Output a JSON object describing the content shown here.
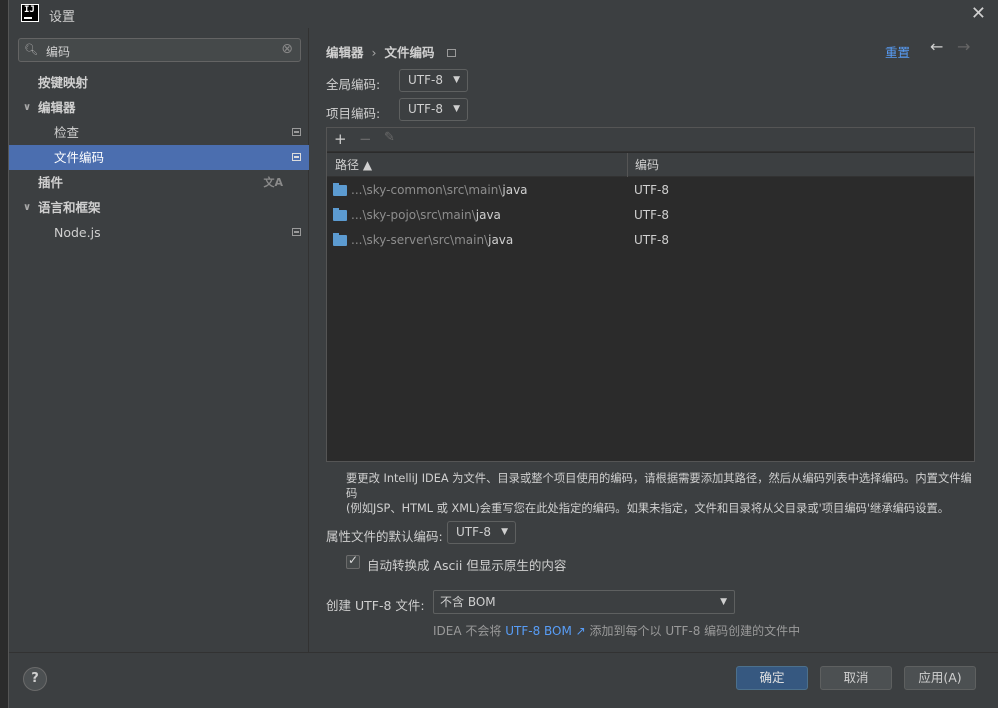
{
  "window": {
    "title": "设置"
  },
  "sidebar": {
    "search": {
      "value": "编码"
    },
    "items": [
      {
        "label": "按键映射"
      },
      {
        "label": "编辑器"
      },
      {
        "label": "检查"
      },
      {
        "label": "文件编码"
      },
      {
        "label": "插件"
      },
      {
        "label": "语言和框架"
      },
      {
        "label": "Node.js"
      }
    ]
  },
  "main": {
    "breadcrumb": {
      "parent": "编辑器",
      "separator": "›",
      "current": "文件编码"
    },
    "reset": "重置",
    "global_encoding": {
      "label": "全局编码:",
      "value": "UTF-8"
    },
    "project_encoding": {
      "label": "项目编码:",
      "value": "UTF-8"
    },
    "table": {
      "columns": [
        "路径 ▲",
        "编码"
      ],
      "rows": [
        {
          "path_prefix": "...\\sky-common\\src\\main\\",
          "path_leaf": "java",
          "encoding": "UTF-8"
        },
        {
          "path_prefix": "...\\sky-pojo\\src\\main\\",
          "path_leaf": "java",
          "encoding": "UTF-8"
        },
        {
          "path_prefix": "...\\sky-server\\src\\main\\",
          "path_leaf": "java",
          "encoding": "UTF-8"
        }
      ]
    },
    "description_line1": "要更改 IntelliJ IDEA 为文件、目录或整个项目使用的编码，请根据需要添加其路径，然后从编码列表中选择编码。内置文件编码",
    "description_line2": "(例如JSP、HTML 或 XML)会重写您在此处指定的编码。如果未指定，文件和目录将从父目录或'项目编码'继承编码设置。",
    "properties_encoding": {
      "label": "属性文件的默认编码:",
      "value": "UTF-8"
    },
    "native_to_ascii": {
      "label": "自动转换成 Ascii 但显示原生的内容",
      "checked": true
    },
    "bom": {
      "label": "创建 UTF-8 文件:",
      "value": "不含 BOM"
    },
    "hint": {
      "prefix": "IDEA 不会将",
      "link": "UTF-8 BOM ↗",
      "suffix": "添加到每个以 UTF-8 编码创建的文件中"
    }
  },
  "footer": {
    "help": "?",
    "ok": "确定",
    "cancel": "取消",
    "apply": "应用(A)"
  }
}
